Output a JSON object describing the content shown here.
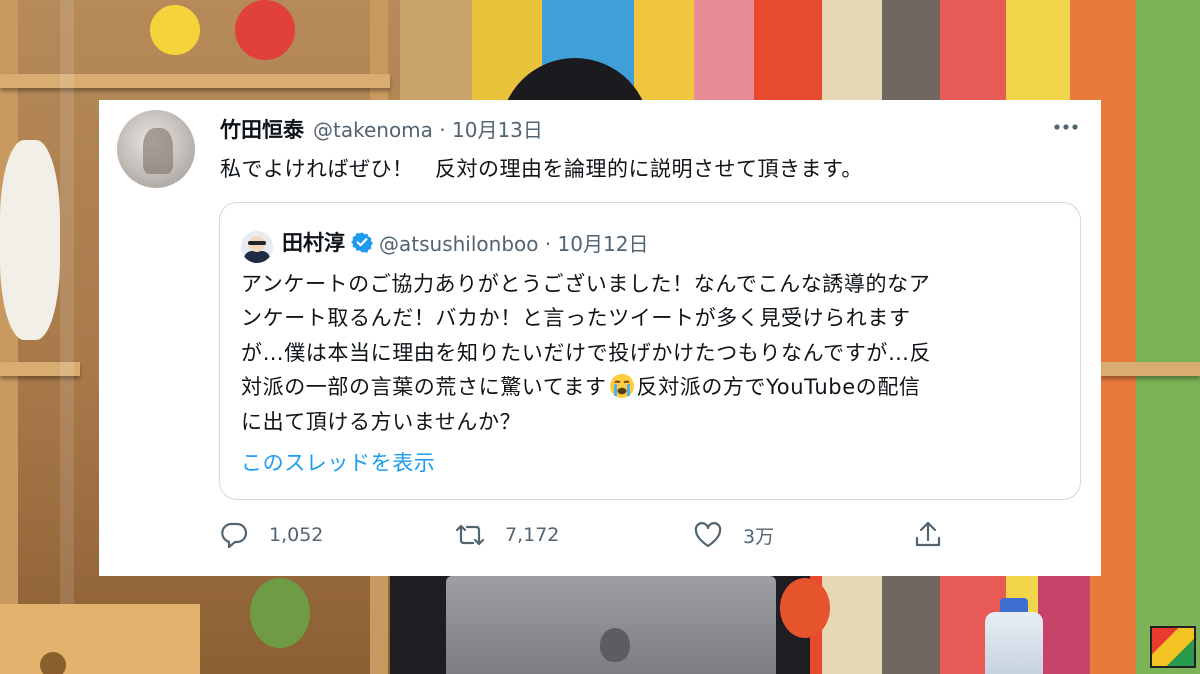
{
  "tweet": {
    "author": {
      "display_name": "竹田恒泰",
      "handle": "@takenoma",
      "date": "10月13日"
    },
    "header_meta": "@takenoma · 10月13日",
    "text": "私でよければぜひ！　反対の理由を論理的に説明させて頂きます。",
    "more_icon": "more-horizontal-icon",
    "quoted": {
      "display_name": "田村淳",
      "verified_icon": "verified-badge-icon",
      "meta": "@atsushilonboo · 10月12日",
      "lines": [
        "アンケートのご協力ありがとうございました！なんでこんな誘導的なア",
        "ンケート取るんだ！バカか！と言ったツイートが多く見受けられます",
        "が…僕は本当に理由を知りたいだけで投げかけたつもりなんですが…反",
        "対派の一部の言葉の荒さに驚いてます",
        "に出て頂ける方いませんか？"
      ],
      "line4_tail": "反対派の方でYouTubeの配信",
      "emoji": "crying-face-emoji",
      "thread_link": "このスレッドを表示"
    },
    "actions": {
      "reply": {
        "icon": "reply-icon",
        "count": "1,052"
      },
      "retweet": {
        "icon": "retweet-icon",
        "count": "7,172"
      },
      "like": {
        "icon": "heart-icon",
        "count": "3万"
      },
      "share": {
        "icon": "share-icon"
      }
    }
  },
  "colors": {
    "link": "#1d9bf0",
    "muted": "#536471",
    "text": "#0f1419",
    "border": "#cfd9de"
  }
}
